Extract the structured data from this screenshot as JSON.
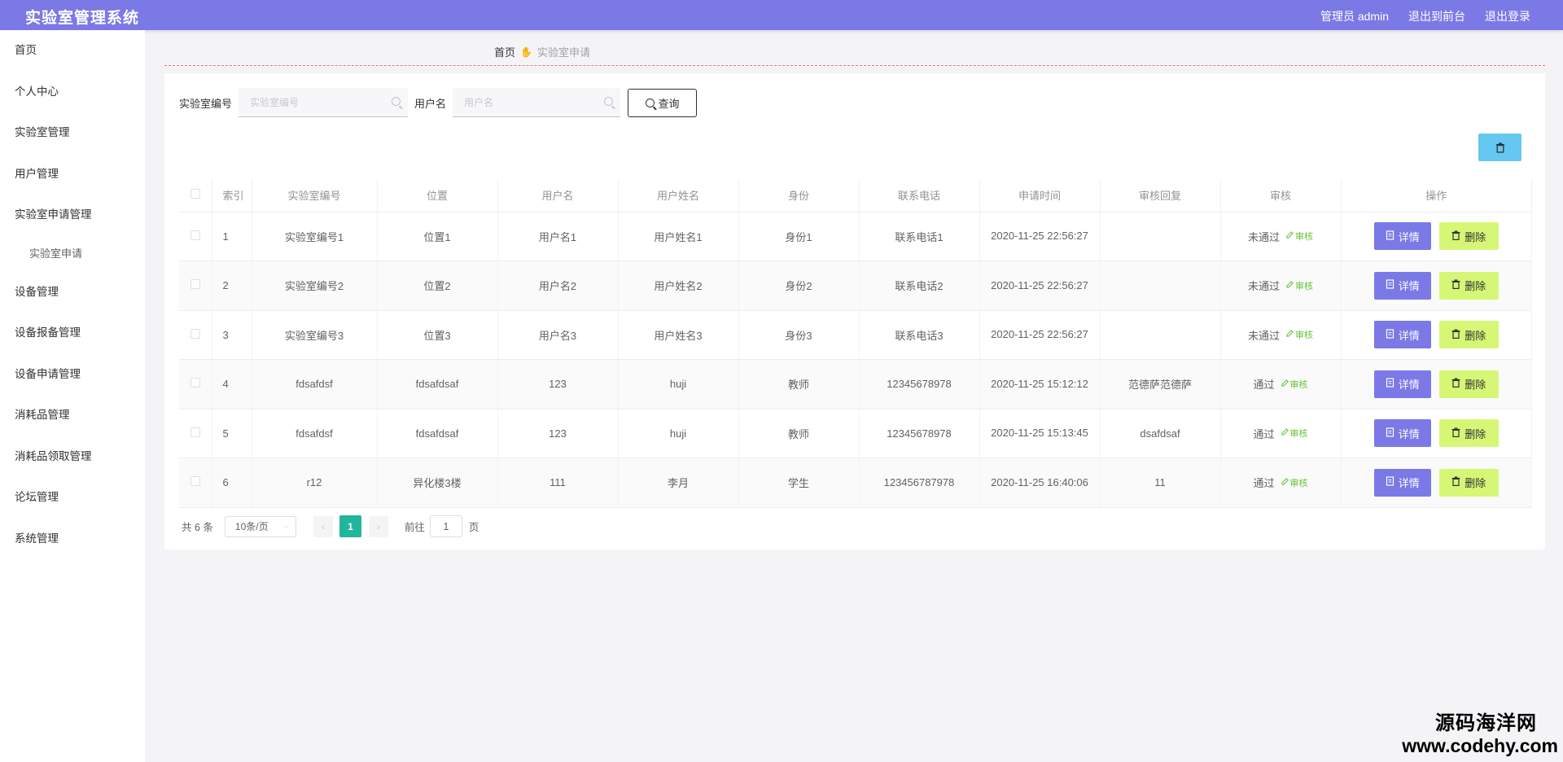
{
  "header": {
    "title": "实验室管理系统",
    "admin": "管理员 admin",
    "front": "退出到前台",
    "logout": "退出登录"
  },
  "sidebar": {
    "items": [
      "首页",
      "个人中心",
      "实验室管理",
      "用户管理",
      "实验室申请管理"
    ],
    "sub_item": "实验室申请",
    "items_after": [
      "设备管理",
      "设备报备管理",
      "设备申请管理",
      "消耗品管理",
      "消耗品领取管理",
      "论坛管理",
      "系统管理"
    ]
  },
  "breadcrumb": {
    "home": "首页",
    "current": "实验室申请"
  },
  "search": {
    "lab_label": "实验室编号",
    "lab_placeholder": "实验室编号",
    "user_label": "用户名",
    "user_placeholder": "用户名",
    "query_label": "查询"
  },
  "table": {
    "headers": [
      "索引",
      "实验室编号",
      "位置",
      "用户名",
      "用户姓名",
      "身份",
      "联系电话",
      "申请时间",
      "审核回复",
      "审核",
      "操作"
    ],
    "review_btn": "审核",
    "detail_btn": "详情",
    "delete_btn": "删除",
    "rows": [
      {
        "idx": "1",
        "lab": "实验室编号1",
        "loc": "位置1",
        "user": "用户名1",
        "name": "用户姓名1",
        "role": "身份1",
        "phone": "联系电话1",
        "time": "2020-11-25 22:56:27",
        "reply": "",
        "status": "未通过"
      },
      {
        "idx": "2",
        "lab": "实验室编号2",
        "loc": "位置2",
        "user": "用户名2",
        "name": "用户姓名2",
        "role": "身份2",
        "phone": "联系电话2",
        "time": "2020-11-25 22:56:27",
        "reply": "",
        "status": "未通过"
      },
      {
        "idx": "3",
        "lab": "实验室编号3",
        "loc": "位置3",
        "user": "用户名3",
        "name": "用户姓名3",
        "role": "身份3",
        "phone": "联系电话3",
        "time": "2020-11-25 22:56:27",
        "reply": "",
        "status": "未通过"
      },
      {
        "idx": "4",
        "lab": "fdsafdsf",
        "loc": "fdsafdsaf",
        "user": "123",
        "name": "huji",
        "role": "教师",
        "phone": "12345678978",
        "time": "2020-11-25 15:12:12",
        "reply": "范德萨范德萨",
        "status": "通过"
      },
      {
        "idx": "5",
        "lab": "fdsafdsf",
        "loc": "fdsafdsaf",
        "user": "123",
        "name": "huji",
        "role": "教师",
        "phone": "12345678978",
        "time": "2020-11-25 15:13:45",
        "reply": "dsafdsaf",
        "status": "通过"
      },
      {
        "idx": "6",
        "lab": "r12",
        "loc": "异化楼3楼",
        "user": "111",
        "name": "李月",
        "role": "学生",
        "phone": "123456787978",
        "time": "2020-11-25 16:40:06",
        "reply": "11",
        "status": "通过"
      }
    ]
  },
  "pager": {
    "total": "共 6 条",
    "page_size": "10条/页",
    "current_page": "1",
    "goto_label": "前往",
    "goto_value": "1",
    "page_unit": "页"
  },
  "watermark": {
    "cn": "源码海洋网",
    "url": "www.codehy.com"
  },
  "colors": {
    "header": "#7b79e6",
    "detail": "#7b79e6",
    "delete": "#d6f776",
    "active_page": "#21b69b",
    "trash": "#64c8f0"
  }
}
